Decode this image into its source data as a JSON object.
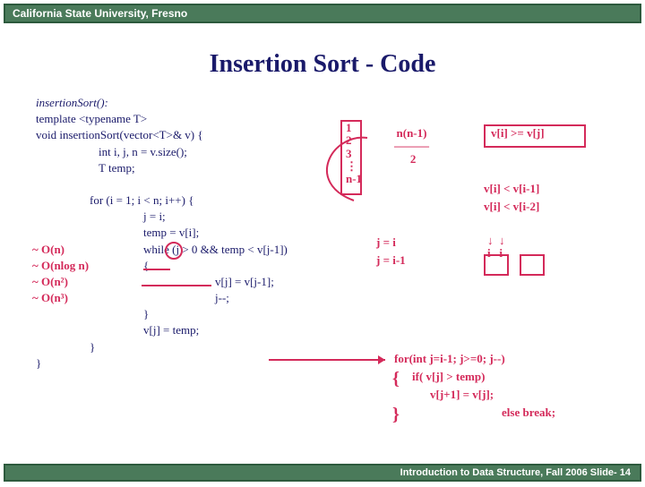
{
  "header": {
    "org": "California State University, Fresno"
  },
  "title": "Insertion Sort - Code",
  "code": {
    "sig": "insertionSort():",
    "tmpl": "template <typename T>",
    "decl": "void insertionSort(vector<T>& v) {",
    "vars": "int i, j, n = v.size();",
    "temp": "T temp;",
    "for_outer": "for (i = 1; i < n; i++)    {",
    "jassign": "j = i;",
    "tempassign": "temp = v[i];",
    "whilecond": "while (j > 0 && temp < v[j-1])",
    "open": "{",
    "shift": "v[j] = v[j-1];",
    "jdec": "j--;",
    "close_inner": "}",
    "store": "v[j] = temp;",
    "close_outer": "}",
    "close_fn": "}"
  },
  "annotations": {
    "On": "~ O(n)",
    "Onlogn": "~ O(nlog n)",
    "On2": "~ O(n²)",
    "On3": "~ O(n³)",
    "list": "1\n2\n3\n⋮\nn-1",
    "frac": "n(n-1)\n———\n 2",
    "cmp": "v[i] >= v[j]",
    "cmp_i1": "v[i] < v[i-1]",
    "cmp_i2": "v[i] < v[i-2]",
    "jdoti": "j = i",
    "jdoti1": "j = i-1",
    "i_caret": "i",
    "j_caret": "↓  ↓\ni   i",
    "pseudo_for": "for(int j=i-1; j>=0; j--)",
    "pseudo_if": "if( v[j] > temp)",
    "pseudo_swap": "v[j+1] = v[j];",
    "pseudo_else": "else break;"
  },
  "footer": {
    "line": "Introduction to Data Structure, Fall 2006  Slide- 14"
  }
}
